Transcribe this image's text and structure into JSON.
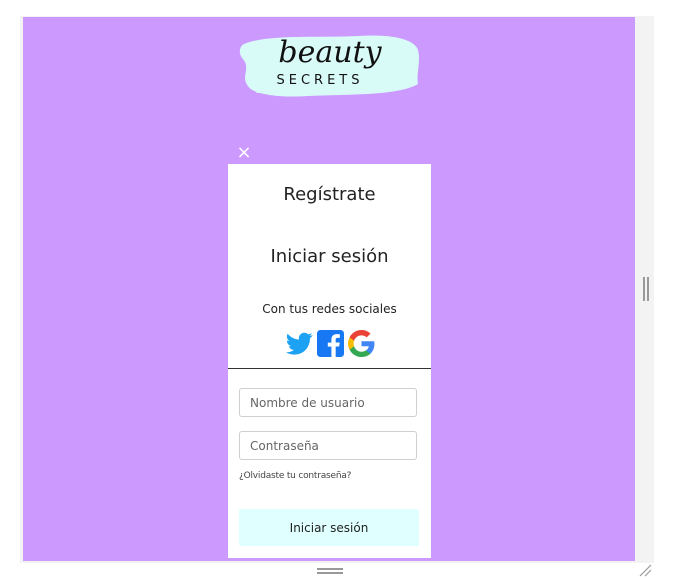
{
  "logo": {
    "word_top": "beauty",
    "word_bottom": "SECRETS"
  },
  "modal": {
    "close_symbol": "×",
    "register_title": "Regístrate",
    "login_title": "Iniciar sesión",
    "social_caption": "Con tus redes sociales",
    "social_icons": [
      "twitter-icon",
      "facebook-icon",
      "google-icon"
    ],
    "username_placeholder": "Nombre de usuario",
    "password_placeholder": "Contraseña",
    "forgot_link": "¿Olvidaste tu contraseña?",
    "submit_label": "Iniciar sesión"
  },
  "colors": {
    "stage_background": "#cc99ff",
    "logo_brush": "#d9fbf8",
    "submit_button": "#e0ffff",
    "twitter": "#1da1f2",
    "facebook": "#1877f2"
  }
}
